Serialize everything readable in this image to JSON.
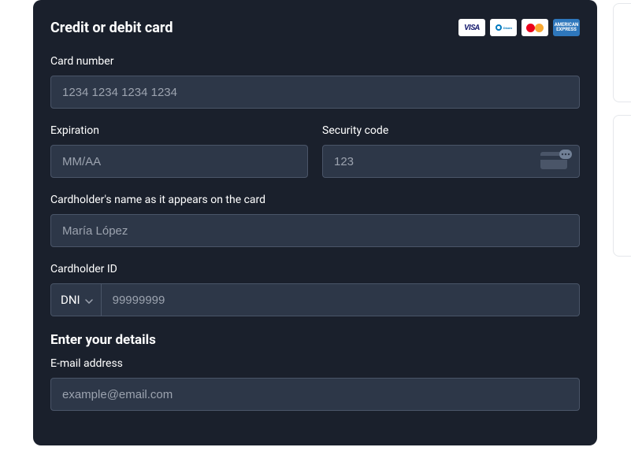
{
  "panel": {
    "title": "Credit or debit card",
    "brands": {
      "visa": "VISA",
      "diners": "Diners",
      "amex_line1": "AMERICAN",
      "amex_line2": "EXPRESS"
    }
  },
  "card_number": {
    "label": "Card number",
    "placeholder": "1234 1234 1234 1234"
  },
  "expiration": {
    "label": "Expiration",
    "placeholder": "MM/AA"
  },
  "security_code": {
    "label": "Security code",
    "placeholder": "123"
  },
  "cardholder_name": {
    "label": "Cardholder's name as it appears on the card",
    "placeholder": "María López"
  },
  "cardholder_id": {
    "label": "Cardholder ID",
    "id_type_selected": "DNI",
    "placeholder": "99999999"
  },
  "details_section": {
    "title": "Enter your details"
  },
  "email": {
    "label": "E-mail address",
    "placeholder": "example@email.com"
  }
}
